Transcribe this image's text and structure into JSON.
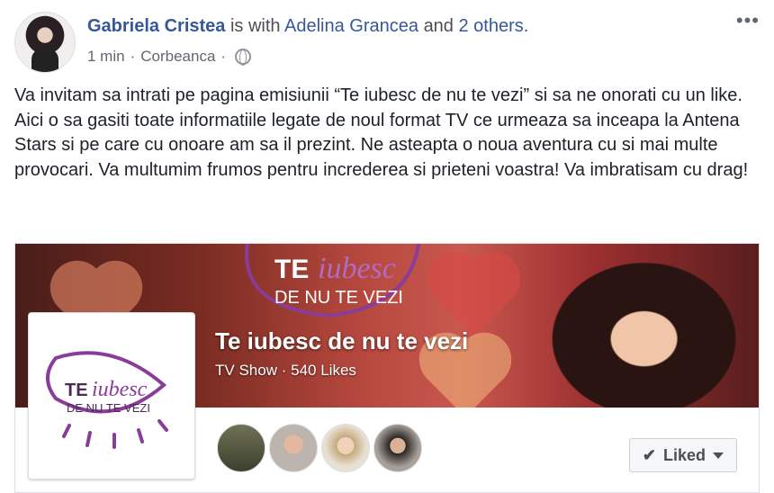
{
  "post": {
    "author": "Gabriela Cristea",
    "with_text": "is with",
    "tagged": "Adelina Grancea",
    "and_text": "and",
    "others": "2 others",
    "period": ".",
    "time": "1 min",
    "location": "Corbeanca",
    "separator": "·",
    "body": "Va invitam sa intrati pe pagina emisiunii “Te iubesc de nu te vezi” si sa ne onorati cu un like. Aici o sa gasiti toate informatiile legate de noul format TV ce urmeaza sa inceapa la Antena Stars si pe care cu onoare am sa il prezint. Ne asteapta o noua aventura cu si mai multe provocari. Va multumim frumos pentru increderea si prieteni voastra! Va imbratisam cu drag!",
    "more_icon": "more-horizontal-icon",
    "privacy_icon": "globe-icon"
  },
  "page_card": {
    "name": "Te iubesc de nu te vezi",
    "category": "TV Show",
    "likes": "540 Likes",
    "logo_te": "TE",
    "logo_iubesc": "iubesc",
    "logo_line2": "DE NU TE VEZI",
    "liked_label": "Liked",
    "check_icon": "check-icon",
    "dropdown_icon": "caret-down-icon",
    "colors": {
      "logo_purple": "#8a3c99",
      "link": "#365899",
      "cover_red": "#b3463c"
    }
  }
}
